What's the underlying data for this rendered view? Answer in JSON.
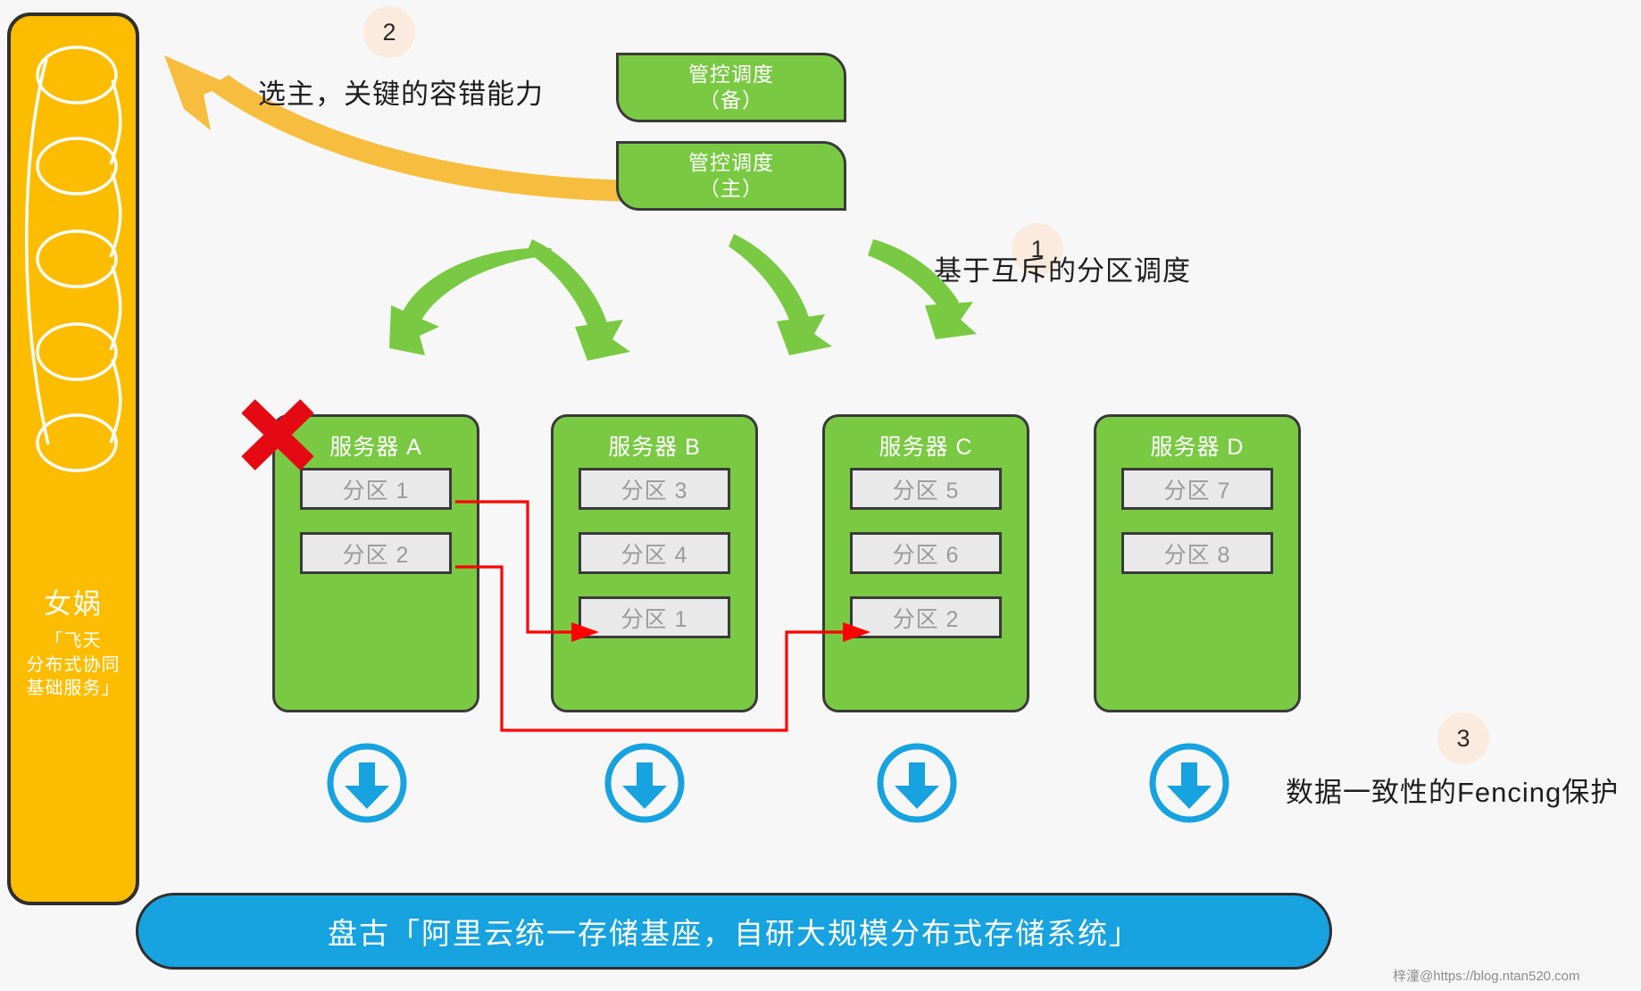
{
  "nuwa_panel": {
    "title": "女娲",
    "subtitle_line1": "「飞天",
    "subtitle_line2": "分布式协同",
    "subtitle_line3": "基础服务」",
    "panel_color": "#fcbd01",
    "coil_icon": "coil-spiral-icon"
  },
  "control_plane": {
    "backup": {
      "line1": "管控调度",
      "line2": "（备）"
    },
    "master": {
      "line1": "管控调度",
      "line2": "（主）"
    },
    "box_color": "#7ac943"
  },
  "annotations": [
    {
      "number": "1",
      "text": "基于互斥的分区调度"
    },
    {
      "number": "2",
      "text": "选主，关键的容错能力"
    },
    {
      "number": "3",
      "text": "数据一致性的Fencing保护"
    }
  ],
  "badge_color": "#fbeade",
  "servers": [
    {
      "name": "服务器 A",
      "failed": true,
      "fail_marker": "red-x-icon",
      "partitions": [
        "分区 1",
        "分区 2"
      ]
    },
    {
      "name": "服务器 B",
      "failed": false,
      "partitions": [
        "分区 3",
        "分区 4",
        "分区 1"
      ]
    },
    {
      "name": "服务器 C",
      "failed": false,
      "partitions": [
        "分区 5",
        "分区 6",
        "分区 2"
      ]
    },
    {
      "name": "服务器 D",
      "failed": false,
      "partitions": [
        "分区 7",
        "分区 8"
      ]
    }
  ],
  "storage_arrows": {
    "icon": "download-arrow-circle-icon",
    "count": 4,
    "color": "#17a2e0"
  },
  "pangu_bar": {
    "text": "盘古「阿里云统一存储基座，自研大规模分布式存储系统」",
    "color": "#17a2e0"
  },
  "migration_links": [
    {
      "from": "服务器 A / 分区 1",
      "to": "服务器 B / 分区 1",
      "color": "#ff0000"
    },
    {
      "from": "服务器 A / 分区 2",
      "to": "服务器 C / 分区 2",
      "color": "#ff0000"
    }
  ],
  "schedule_arrows": {
    "count": 4,
    "color": "#7ac943"
  },
  "election_arrow": {
    "color": "#f7bd3f"
  },
  "watermark": "梓潼@https://blog.ntan520.com"
}
